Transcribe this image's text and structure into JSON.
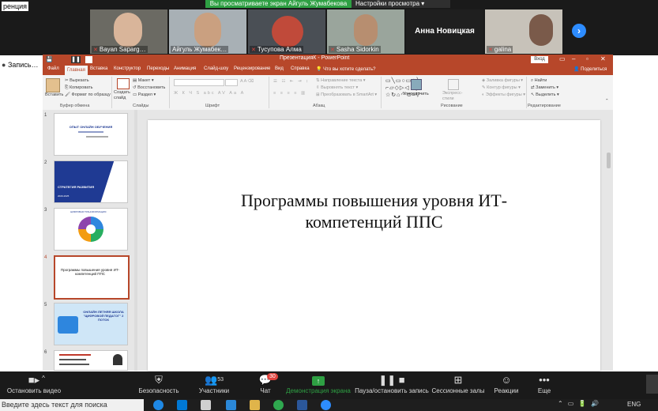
{
  "zoom": {
    "window_label_fragment": "ренция",
    "share_banner": "Вы просматриваете экран Айгуль Жумабекова",
    "view_settings": "Настройки просмотра",
    "participants": [
      {
        "name": "Bayan Saparg…",
        "muted": true
      },
      {
        "name": "Айгуль Жумабек…",
        "muted": false
      },
      {
        "name": "Тусупова Алма",
        "muted": true
      },
      {
        "name": "Sasha Sidorkin",
        "muted": true
      },
      {
        "name": "Анна Новицкая",
        "muted": false,
        "no_video": true
      },
      {
        "name": "galina",
        "muted": true
      }
    ],
    "record_label": "Запись…",
    "toolbar": {
      "stop_video": "Остановить видео",
      "security": "Безопасность",
      "participants": "Участники",
      "participants_count": "53",
      "chat": "Чат",
      "chat_badge": "30",
      "share_screen": "Демонстрация экрана",
      "pause_record": "Пауза/остановить запись",
      "breakout_rooms": "Сессионные залы",
      "reactions": "Реакции",
      "more": "Еще"
    }
  },
  "powerpoint": {
    "title": "ПрезентацияК  -  PowerPoint",
    "login": "Вход",
    "tabs": [
      "Файл",
      "Главная",
      "Вставка",
      "Конструктор",
      "Переходы",
      "Анимация",
      "Слайд-шоу",
      "Рецензирование",
      "Вид",
      "Справка",
      "Что вы хотите сделать?"
    ],
    "share": "Поделиться",
    "ribbon": {
      "paste": "Вставить",
      "cut": "Вырезать",
      "copy": "Копировать",
      "format_painter": "Формат по образцу",
      "clipboard": "Буфер обмена",
      "new_slide": "Создать слайд",
      "layout": "Макет",
      "reset": "Восстановить",
      "section": "Раздел",
      "slides": "Слайды",
      "font": "Шрифт",
      "paragraph": "Абзац",
      "text_direction": "Направление текста",
      "align_text": "Выровнять текст",
      "convert_smartart": "Преобразовать в SmartArt",
      "arrange": "Упорядочить",
      "quick_styles": "Экспресс-стили",
      "drawing": "Рисование",
      "shape_fill": "Заливка фигуры",
      "shape_outline": "Контур фигуры",
      "shape_effects": "Эффекты фигуры",
      "find": "Найти",
      "replace": "Заменить",
      "select": "Выделить",
      "editing": "Редактирование"
    },
    "thumbnails": [
      {
        "n": "1",
        "text": "ОПЫТ ОНЛАЙН ОБУЧЕНИЯ"
      },
      {
        "n": "2",
        "text": "СТРАТЕГИЯ РАЗВИТИЯ",
        "sub": "2020-2025"
      },
      {
        "n": "3",
        "text": "ЦИФРОВАЯ ТРАНСФОРМАЦИЯ"
      },
      {
        "n": "4",
        "text": "Программы повышения уровня ИТ-компетенций ППС"
      },
      {
        "n": "5",
        "text": "ОНЛАЙН ЛЕТНЯЯ ШКОЛА \"ЦИФРОВОЙ ПЕДАГОГ\" 2 ПОТОК"
      },
      {
        "n": "6",
        "text": ""
      }
    ],
    "slide_title_line1": "Программы повышения уровня ИТ-",
    "slide_title_line2": "компетенций ППС"
  },
  "taskbar": {
    "search_placeholder": "Введите здесь текст для поиска",
    "lang": "ENG"
  },
  "colors": {
    "ppt_accent": "#b7472a",
    "zoom_bg": "#1a1a1a",
    "share_green": "#2ea043",
    "zoom_blue": "#2d8cff"
  }
}
